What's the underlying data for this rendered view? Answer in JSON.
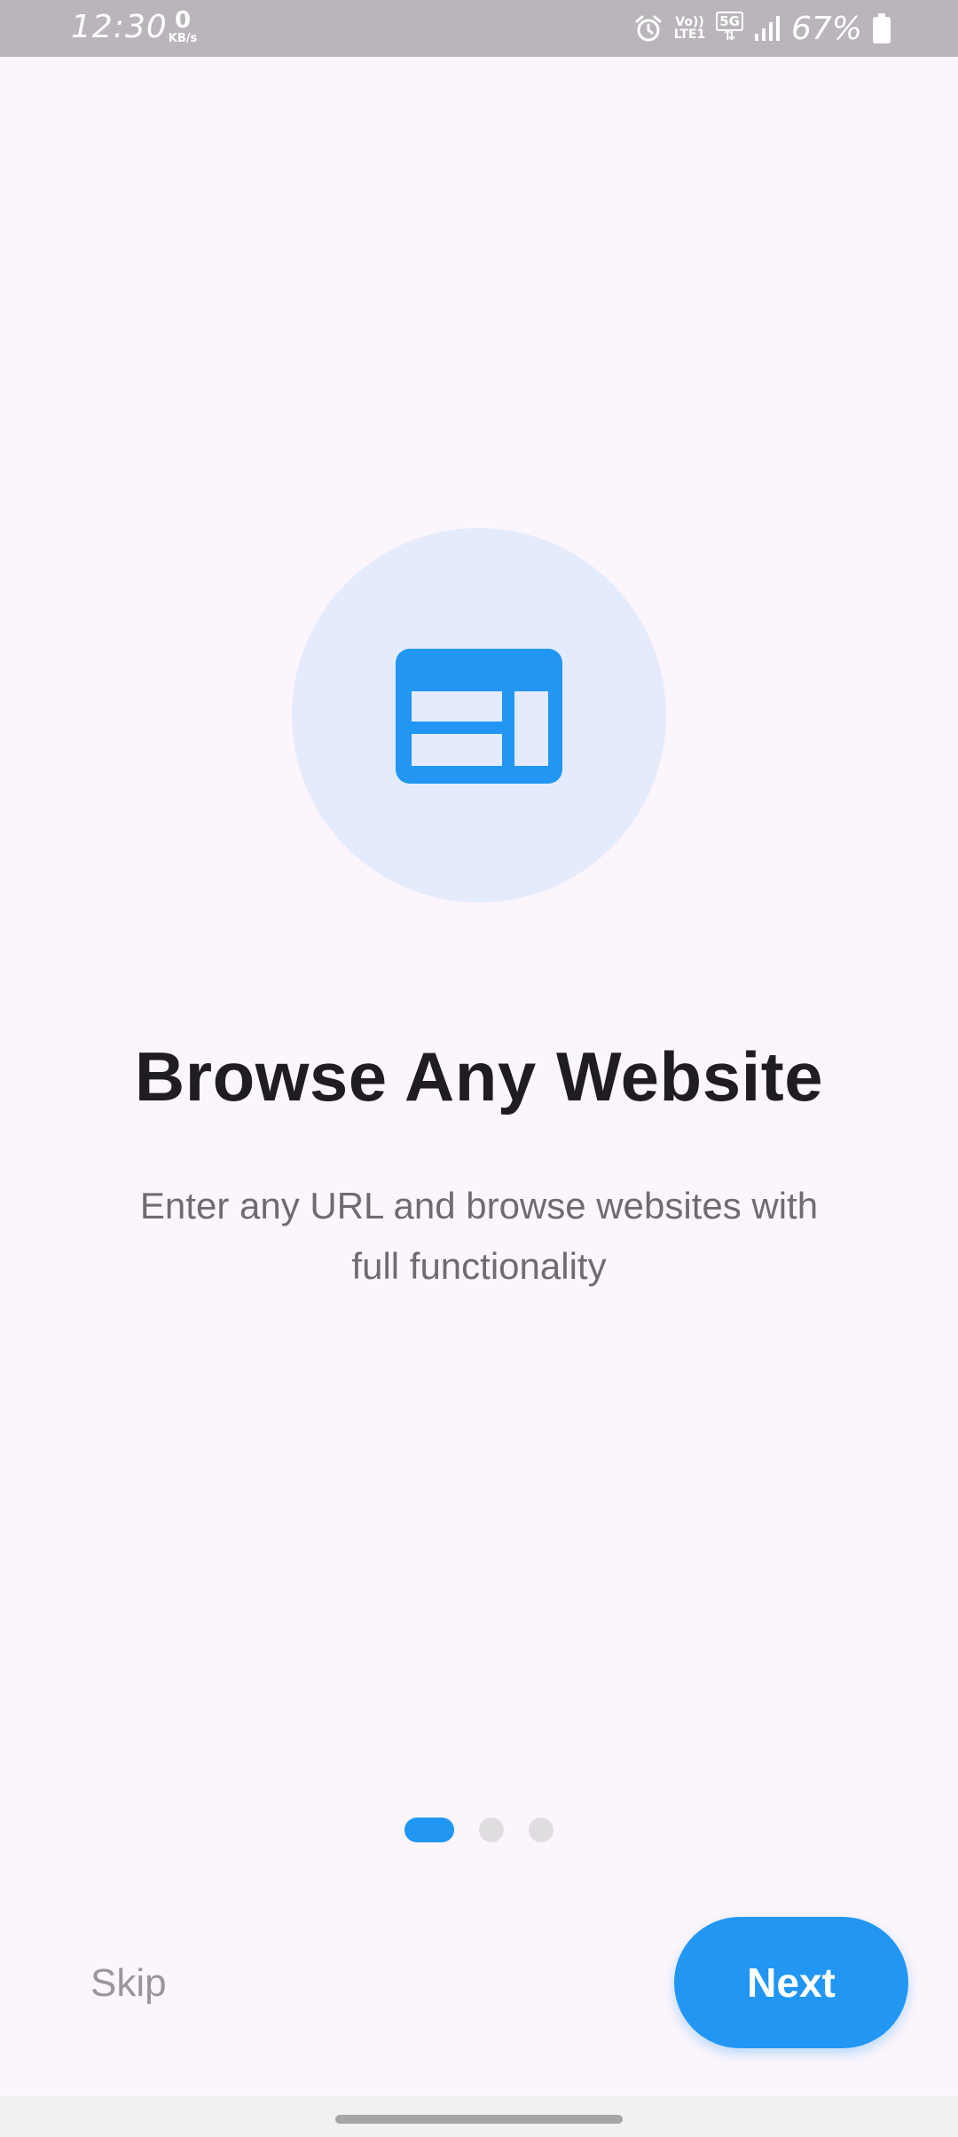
{
  "status_bar": {
    "time": "12:30",
    "net_speed_value": "0",
    "net_speed_unit": "KB/s",
    "volte_label": "Vo))",
    "lte_label": "LTE1",
    "network_type": "5G",
    "battery_percent": "67%",
    "icons": [
      "alarm-icon",
      "signal-icon",
      "battery-icon"
    ]
  },
  "onboarding": {
    "icon": "web-layout-icon",
    "title": "Browse Any Website",
    "subtitle_line1": "Enter any URL and browse websites with",
    "subtitle_line2": "full functionality",
    "page_indicator": {
      "current": 1,
      "total": 3
    }
  },
  "actions": {
    "skip_label": "Skip",
    "next_label": "Next"
  },
  "colors": {
    "accent": "#2196f3",
    "background": "#fcf6fc",
    "hero_circle": "#e4ebfc",
    "title": "#1f1d22",
    "subtitle": "#6f6b73",
    "skip": "#9a959b"
  }
}
